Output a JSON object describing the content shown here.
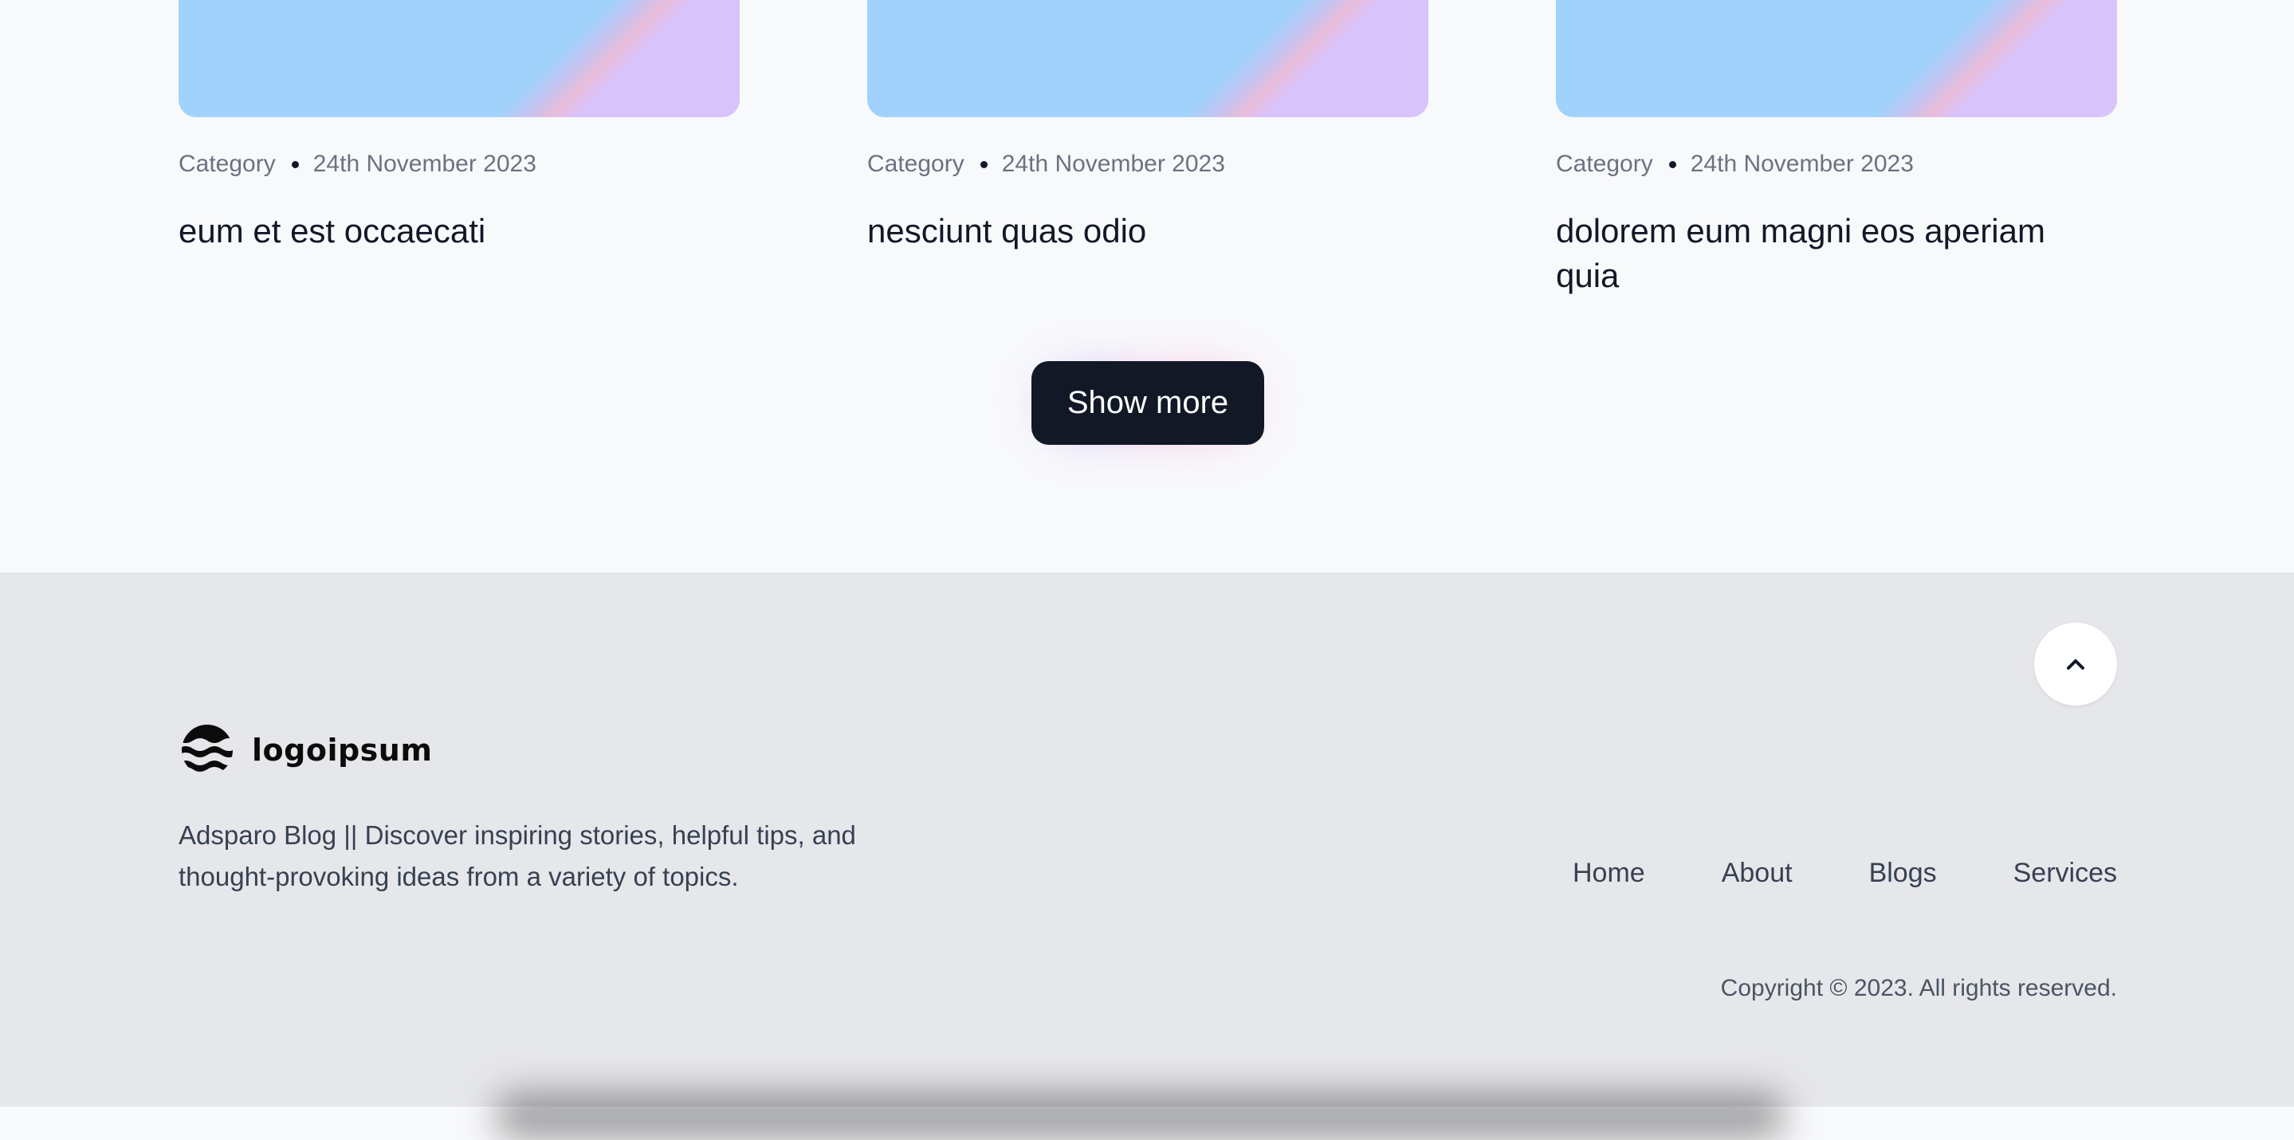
{
  "blog": {
    "posts": [
      {
        "category": "Category",
        "date": "24th November 2023",
        "title": "eum et est occaecati"
      },
      {
        "category": "Category",
        "date": "24th November 2023",
        "title": "nesciunt quas odio"
      },
      {
        "category": "Category",
        "date": "24th November 2023",
        "title": "dolorem eum magni eos aperiam quia"
      }
    ],
    "show_more_label": "Show more"
  },
  "footer": {
    "scroll_top_icon": "chevron-up-icon",
    "logo_text": "logoipsum",
    "description": "Adsparo Blog || Discover inspiring stories, helpful tips, and thought-provoking ideas from a variety of topics.",
    "nav": [
      {
        "label": "Home"
      },
      {
        "label": "About"
      },
      {
        "label": "Blogs"
      },
      {
        "label": "Services"
      }
    ],
    "copyright": "Copyright © 2023. All rights reserved."
  },
  "colors": {
    "page_background": "#f8f9fb",
    "footer_background": "#e6e7eb",
    "button_background": "#121826",
    "image_blue": "#a1d2fb",
    "image_violet": "#d8c3fb"
  }
}
